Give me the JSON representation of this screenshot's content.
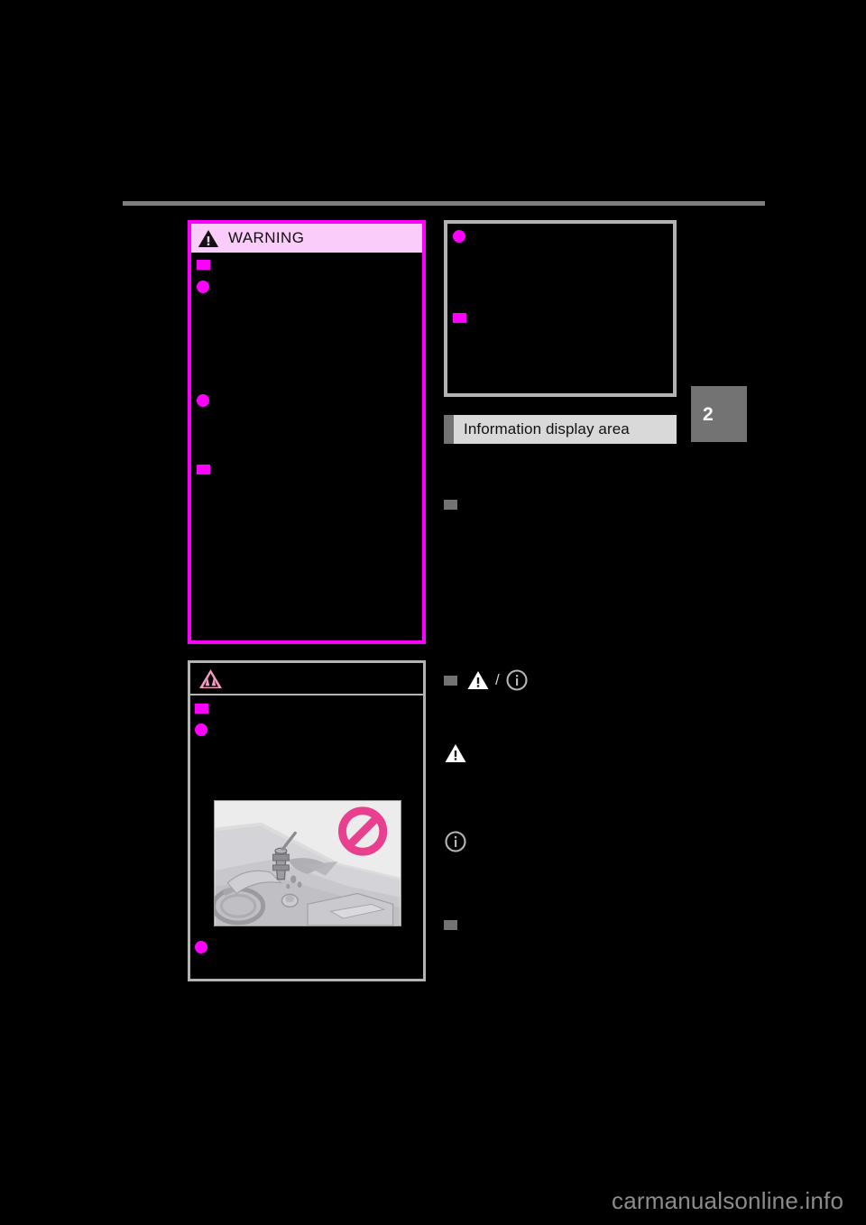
{
  "page": {
    "number_tab": "2",
    "watermark": "carmanualsonline.info"
  },
  "left_column": {
    "warning_box": {
      "header_label": "WARNING",
      "header_icon": "warning-triangle-icon",
      "header_bg": "#F9CCF9",
      "border_color": "#FF00FF",
      "markers": [
        {
          "type": "square",
          "color": "#FF00FF"
        },
        {
          "type": "dot",
          "color": "#FF00FF"
        },
        {
          "type": "dot",
          "color": "#FF00FF"
        },
        {
          "type": "square",
          "color": "#FF00FF"
        }
      ]
    },
    "notice_box": {
      "header_icon": "warning-triangle-pink-icon",
      "border_color": "#B3B3B3",
      "markers": [
        {
          "type": "square",
          "color": "#FF00FF"
        },
        {
          "type": "dot",
          "color": "#FF00FF"
        },
        {
          "type": "dot",
          "color": "#FF00FF"
        }
      ],
      "illustration": {
        "name": "spilled-drink-on-dashboard-illustration",
        "prohibition_symbol": "no-sign-icon",
        "prohibition_color": "#E8408F",
        "background": "#EAEAEA"
      }
    }
  },
  "right_column": {
    "top_box": {
      "border_color": "#B3B3B3",
      "markers": [
        {
          "type": "dot",
          "color": "#FF00FF"
        },
        {
          "type": "square",
          "color": "#FF00FF"
        }
      ]
    },
    "section_header": {
      "title": "Information display area",
      "tab_color": "#737373",
      "bar_color": "#D9D9D9"
    },
    "markers": [
      {
        "type": "square",
        "color": "#737373"
      },
      {
        "type": "square",
        "color": "#737373"
      },
      {
        "type": "square",
        "color": "#737373"
      }
    ],
    "icon_row": {
      "separator": "/",
      "icons": [
        "warning-triangle-icon",
        "info-circle-icon"
      ]
    },
    "standalone_icons": [
      "warning-triangle-icon",
      "info-circle-icon"
    ]
  }
}
